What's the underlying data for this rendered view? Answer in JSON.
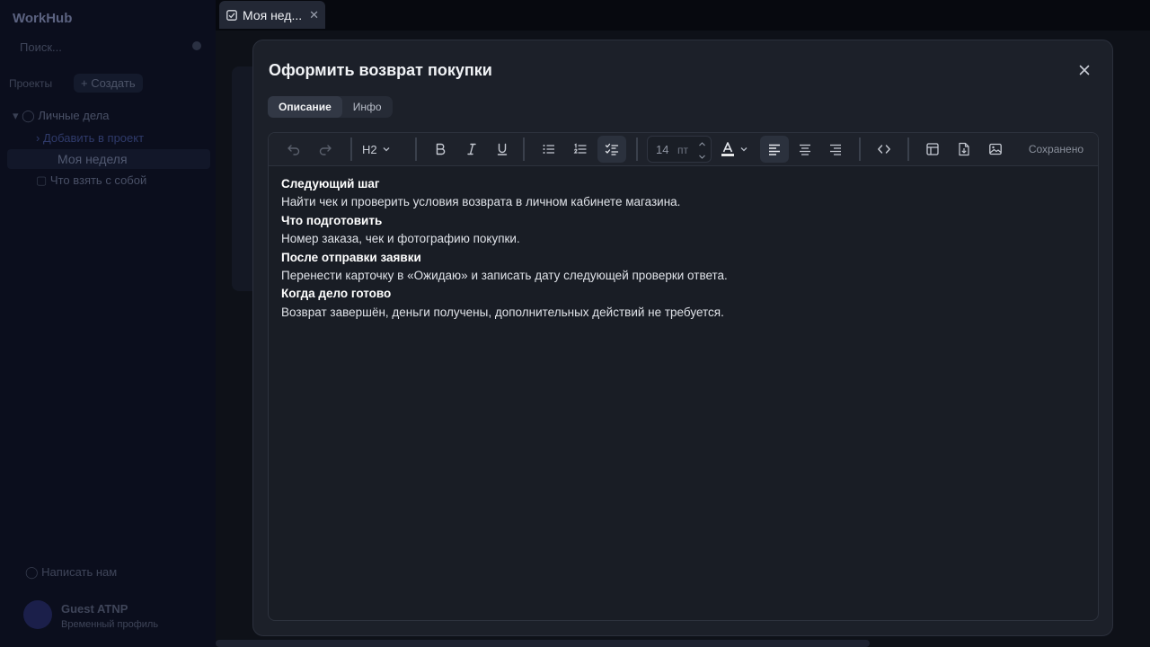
{
  "app": {
    "logo": "WorkHub",
    "search_placeholder": "Поиск...",
    "projects_label": "Проекты",
    "create_label": "+ Создать",
    "tree": {
      "group": "Личные дела",
      "add_project": "› Добавить в проект",
      "item_active": "Моя неделя",
      "item_other": "Что взять с собой"
    },
    "contact_label": "Написать нам",
    "user_name": "Guest ATNP",
    "user_sub": "Временный профиль"
  },
  "tab": {
    "title": "Моя нед...",
    "icon": "checkbox-icon"
  },
  "modal": {
    "title": "Оформить возврат покупки",
    "tabs": [
      {
        "label": "Описание",
        "active": true
      },
      {
        "label": "Инфо",
        "active": false
      }
    ]
  },
  "toolbar": {
    "heading": "H2",
    "font_size": "14",
    "font_unit": "пт",
    "status": "Сохранено",
    "accent": "#2b313d"
  },
  "content": [
    {
      "type": "heading",
      "text": "Следующий шаг"
    },
    {
      "type": "text",
      "text": "Найти чек и проверить условия возврата в личном кабинете магазина."
    },
    {
      "type": "heading",
      "text": "Что подготовить"
    },
    {
      "type": "text",
      "text": "Номер заказа, чек и фотографию покупки."
    },
    {
      "type": "heading",
      "text": "После отправки заявки"
    },
    {
      "type": "text",
      "text": "Перенести карточку в «Ожидаю» и записать дату следующей проверки ответа."
    },
    {
      "type": "heading",
      "text": "Когда дело готово"
    },
    {
      "type": "text",
      "text": "Возврат завершён, деньги получены, дополнительных действий не требуется."
    }
  ]
}
